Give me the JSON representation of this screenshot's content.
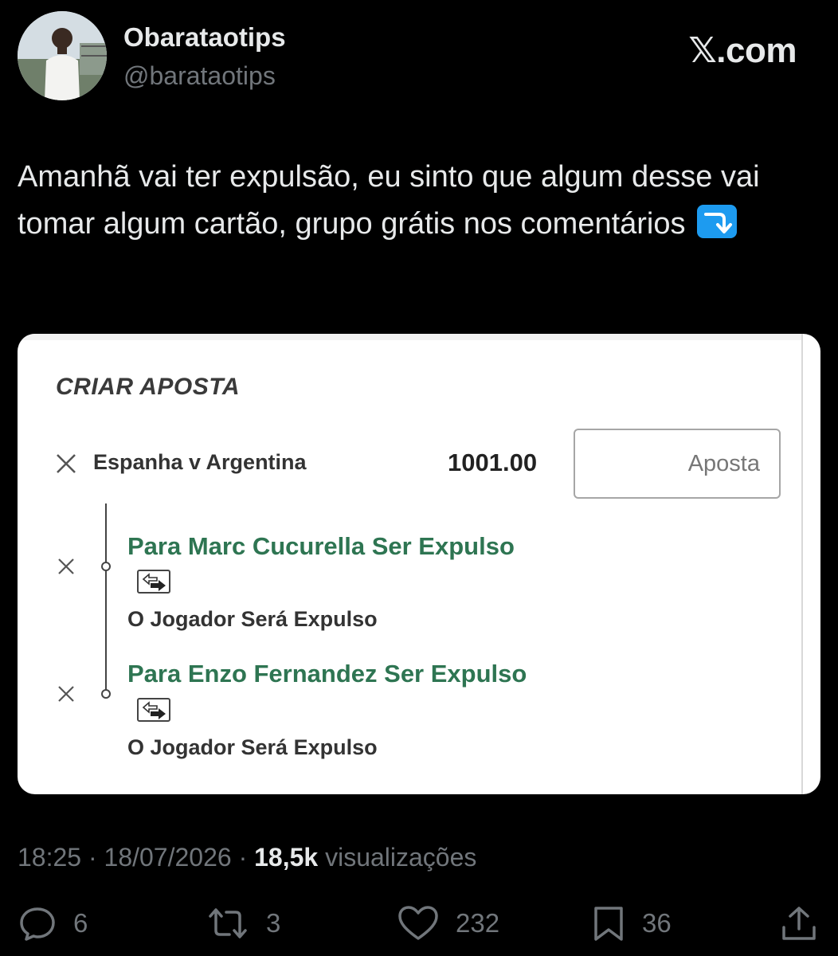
{
  "author": {
    "display_name": "Obarataotips",
    "handle": "@baratаotips"
  },
  "brand": "𝕏.com",
  "tweet": {
    "text": "Amanhã vai ter expulsão, eu sinto que algum desse vai tomar algum cartão, grupo grátis nos comentários",
    "emoji": "right-arrow-curving-down"
  },
  "bet_slip": {
    "title": "CRIAR APOSTA",
    "match": "Espanha v Argentina",
    "odds": "1001.00",
    "stake_placeholder": "Aposta",
    "selections": [
      {
        "title": "Para Marc Cucurella Ser Expulso",
        "market": "O Jogador Será Expulso"
      },
      {
        "title": "Para Enzo Fernandez Ser Expulso",
        "market": "O Jogador Será Expulso"
      }
    ]
  },
  "meta": {
    "time": "18:25",
    "date": "18/07/2026",
    "views_count": "18,5k",
    "views_label": "visualizações"
  },
  "actions": {
    "replies": "6",
    "reposts": "3",
    "likes": "232",
    "bookmarks": "36"
  },
  "colors": {
    "background": "#000000",
    "selection_green": "#2e7552",
    "muted": "#71767b",
    "emoji_blue": "#1d9bf0"
  }
}
